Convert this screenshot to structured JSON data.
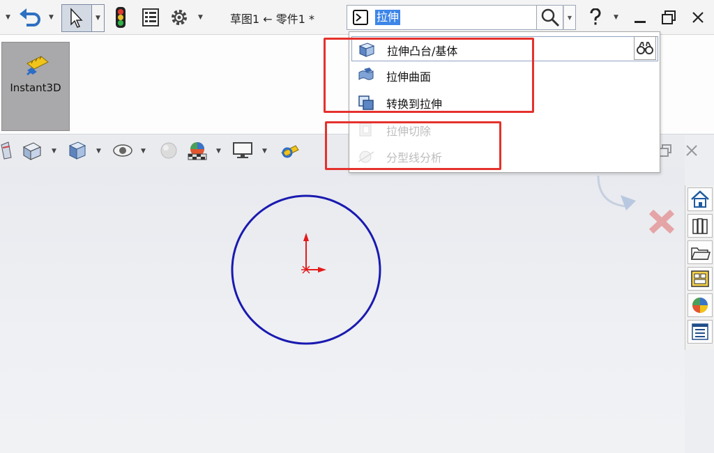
{
  "window": {
    "title": "草图1 ← 零件1 *"
  },
  "search": {
    "value": "拉伸"
  },
  "ribbon": {
    "instant3d_label": "Instant3D"
  },
  "dropdown": {
    "items": [
      {
        "label": "拉伸凸台/基体",
        "enabled": true
      },
      {
        "label": "拉伸曲面",
        "enabled": true
      },
      {
        "label": "转换到拉伸",
        "enabled": true
      },
      {
        "label": "拉伸切除",
        "enabled": false
      },
      {
        "label": "分型线分析",
        "enabled": false
      }
    ]
  },
  "colors": {
    "highlight_box": "#e5312c",
    "sketch_circle": "#1a1ab0",
    "origin": "#e31b1b",
    "search_selection": "#3d86e8"
  },
  "icons": {
    "toolbar": [
      "undo-icon",
      "select-cursor-icon",
      "traffic-light-icon",
      "file-properties-icon",
      "options-gear-icon",
      "command-prompt-icon",
      "search-magnifier-icon",
      "help-icon"
    ],
    "taskpane": [
      "home-icon",
      "design-library-icon",
      "file-explorer-icon",
      "view-palette-icon",
      "appearances-icon",
      "custom-properties-icon"
    ]
  }
}
